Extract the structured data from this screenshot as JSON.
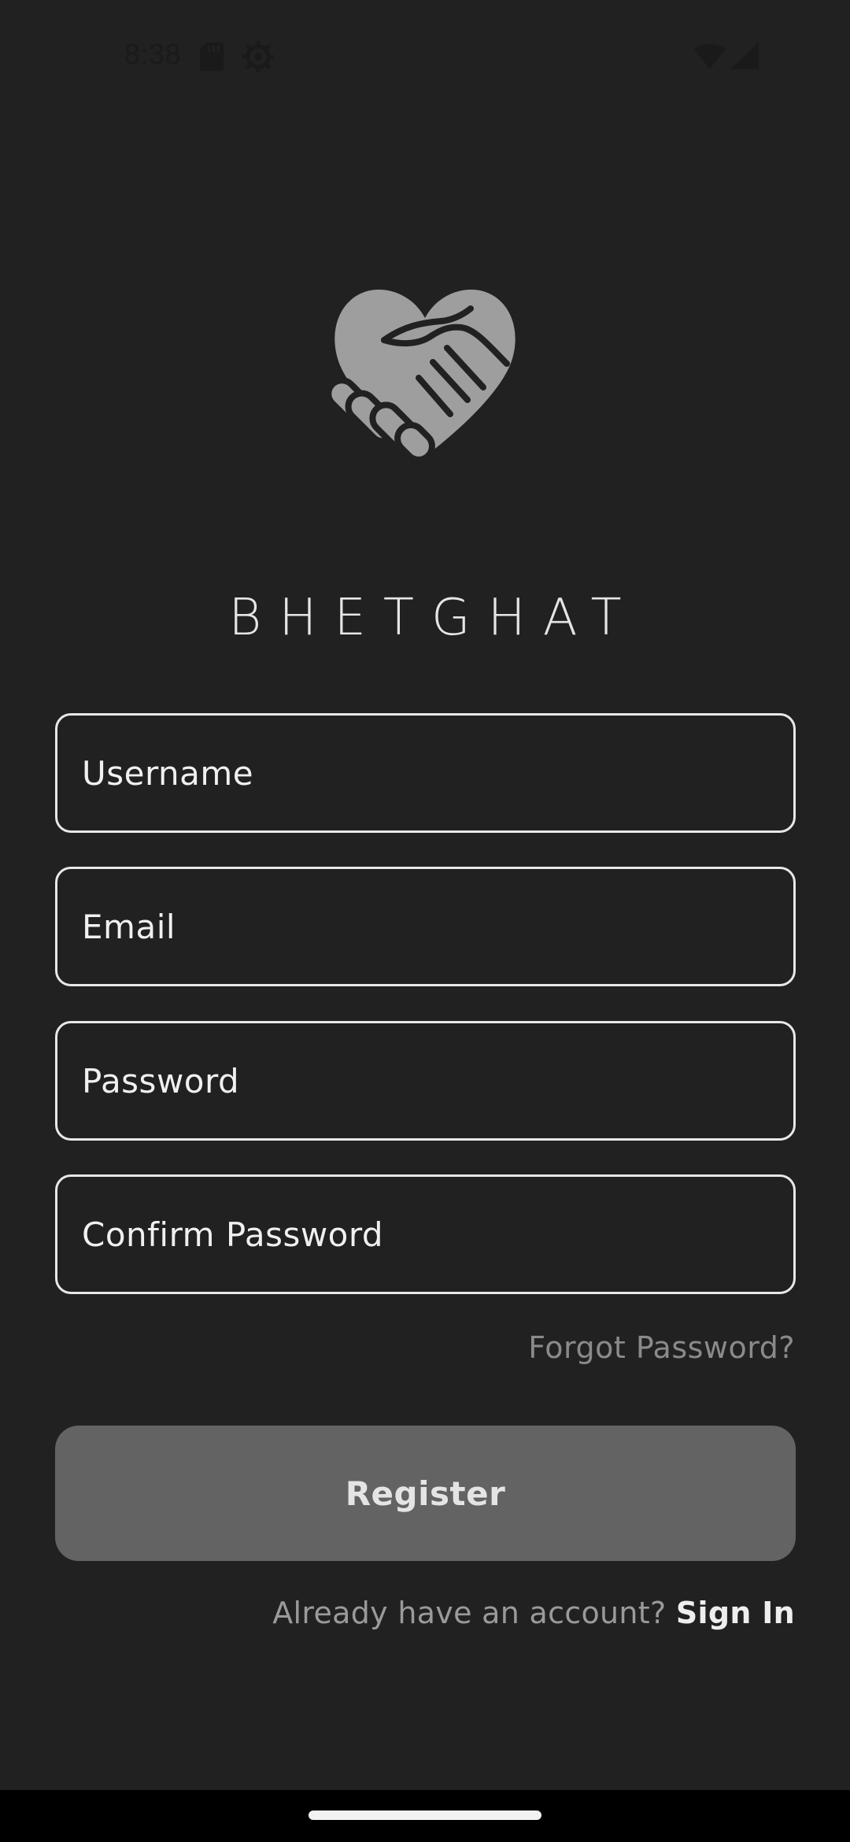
{
  "status_bar": {
    "time": "8:38",
    "icons": [
      "sd-card-icon",
      "settings-gear-icon",
      "wifi-icon",
      "cell-signal-icon"
    ]
  },
  "app": {
    "logo_icon": "heart-handshake-icon",
    "title": "BHETGHAT"
  },
  "form": {
    "username_placeholder": "Username",
    "email_placeholder": "Email",
    "password_placeholder": "Password",
    "confirm_password_placeholder": "Confirm Password",
    "forgot_password_label": "Forgot Password?",
    "register_label": "Register",
    "signin_prompt": "Already have an account?",
    "signin_label": "Sign In"
  },
  "colors": {
    "background": "#212121",
    "field_border": "#e8e8e8",
    "button_background": "#636363",
    "muted_text": "#8a8a8a",
    "logo": "#9e9e9e"
  }
}
